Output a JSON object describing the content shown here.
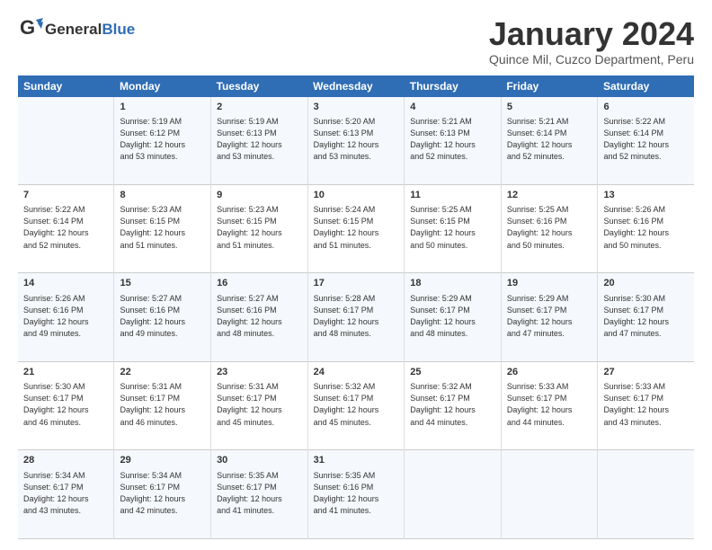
{
  "logo": {
    "general": "General",
    "blue": "Blue"
  },
  "title": "January 2024",
  "subtitle": "Quince Mil, Cuzco Department, Peru",
  "header_days": [
    "Sunday",
    "Monday",
    "Tuesday",
    "Wednesday",
    "Thursday",
    "Friday",
    "Saturday"
  ],
  "weeks": [
    [
      {
        "day": "",
        "content": ""
      },
      {
        "day": "1",
        "content": "Sunrise: 5:19 AM\nSunset: 6:12 PM\nDaylight: 12 hours\nand 53 minutes."
      },
      {
        "day": "2",
        "content": "Sunrise: 5:19 AM\nSunset: 6:13 PM\nDaylight: 12 hours\nand 53 minutes."
      },
      {
        "day": "3",
        "content": "Sunrise: 5:20 AM\nSunset: 6:13 PM\nDaylight: 12 hours\nand 53 minutes."
      },
      {
        "day": "4",
        "content": "Sunrise: 5:21 AM\nSunset: 6:13 PM\nDaylight: 12 hours\nand 52 minutes."
      },
      {
        "day": "5",
        "content": "Sunrise: 5:21 AM\nSunset: 6:14 PM\nDaylight: 12 hours\nand 52 minutes."
      },
      {
        "day": "6",
        "content": "Sunrise: 5:22 AM\nSunset: 6:14 PM\nDaylight: 12 hours\nand 52 minutes."
      }
    ],
    [
      {
        "day": "7",
        "content": "Sunrise: 5:22 AM\nSunset: 6:14 PM\nDaylight: 12 hours\nand 52 minutes."
      },
      {
        "day": "8",
        "content": "Sunrise: 5:23 AM\nSunset: 6:15 PM\nDaylight: 12 hours\nand 51 minutes."
      },
      {
        "day": "9",
        "content": "Sunrise: 5:23 AM\nSunset: 6:15 PM\nDaylight: 12 hours\nand 51 minutes."
      },
      {
        "day": "10",
        "content": "Sunrise: 5:24 AM\nSunset: 6:15 PM\nDaylight: 12 hours\nand 51 minutes."
      },
      {
        "day": "11",
        "content": "Sunrise: 5:25 AM\nSunset: 6:15 PM\nDaylight: 12 hours\nand 50 minutes."
      },
      {
        "day": "12",
        "content": "Sunrise: 5:25 AM\nSunset: 6:16 PM\nDaylight: 12 hours\nand 50 minutes."
      },
      {
        "day": "13",
        "content": "Sunrise: 5:26 AM\nSunset: 6:16 PM\nDaylight: 12 hours\nand 50 minutes."
      }
    ],
    [
      {
        "day": "14",
        "content": "Sunrise: 5:26 AM\nSunset: 6:16 PM\nDaylight: 12 hours\nand 49 minutes."
      },
      {
        "day": "15",
        "content": "Sunrise: 5:27 AM\nSunset: 6:16 PM\nDaylight: 12 hours\nand 49 minutes."
      },
      {
        "day": "16",
        "content": "Sunrise: 5:27 AM\nSunset: 6:16 PM\nDaylight: 12 hours\nand 48 minutes."
      },
      {
        "day": "17",
        "content": "Sunrise: 5:28 AM\nSunset: 6:17 PM\nDaylight: 12 hours\nand 48 minutes."
      },
      {
        "day": "18",
        "content": "Sunrise: 5:29 AM\nSunset: 6:17 PM\nDaylight: 12 hours\nand 48 minutes."
      },
      {
        "day": "19",
        "content": "Sunrise: 5:29 AM\nSunset: 6:17 PM\nDaylight: 12 hours\nand 47 minutes."
      },
      {
        "day": "20",
        "content": "Sunrise: 5:30 AM\nSunset: 6:17 PM\nDaylight: 12 hours\nand 47 minutes."
      }
    ],
    [
      {
        "day": "21",
        "content": "Sunrise: 5:30 AM\nSunset: 6:17 PM\nDaylight: 12 hours\nand 46 minutes."
      },
      {
        "day": "22",
        "content": "Sunrise: 5:31 AM\nSunset: 6:17 PM\nDaylight: 12 hours\nand 46 minutes."
      },
      {
        "day": "23",
        "content": "Sunrise: 5:31 AM\nSunset: 6:17 PM\nDaylight: 12 hours\nand 45 minutes."
      },
      {
        "day": "24",
        "content": "Sunrise: 5:32 AM\nSunset: 6:17 PM\nDaylight: 12 hours\nand 45 minutes."
      },
      {
        "day": "25",
        "content": "Sunrise: 5:32 AM\nSunset: 6:17 PM\nDaylight: 12 hours\nand 44 minutes."
      },
      {
        "day": "26",
        "content": "Sunrise: 5:33 AM\nSunset: 6:17 PM\nDaylight: 12 hours\nand 44 minutes."
      },
      {
        "day": "27",
        "content": "Sunrise: 5:33 AM\nSunset: 6:17 PM\nDaylight: 12 hours\nand 43 minutes."
      }
    ],
    [
      {
        "day": "28",
        "content": "Sunrise: 5:34 AM\nSunset: 6:17 PM\nDaylight: 12 hours\nand 43 minutes."
      },
      {
        "day": "29",
        "content": "Sunrise: 5:34 AM\nSunset: 6:17 PM\nDaylight: 12 hours\nand 42 minutes."
      },
      {
        "day": "30",
        "content": "Sunrise: 5:35 AM\nSunset: 6:17 PM\nDaylight: 12 hours\nand 41 minutes."
      },
      {
        "day": "31",
        "content": "Sunrise: 5:35 AM\nSunset: 6:16 PM\nDaylight: 12 hours\nand 41 minutes."
      },
      {
        "day": "",
        "content": ""
      },
      {
        "day": "",
        "content": ""
      },
      {
        "day": "",
        "content": ""
      }
    ]
  ]
}
